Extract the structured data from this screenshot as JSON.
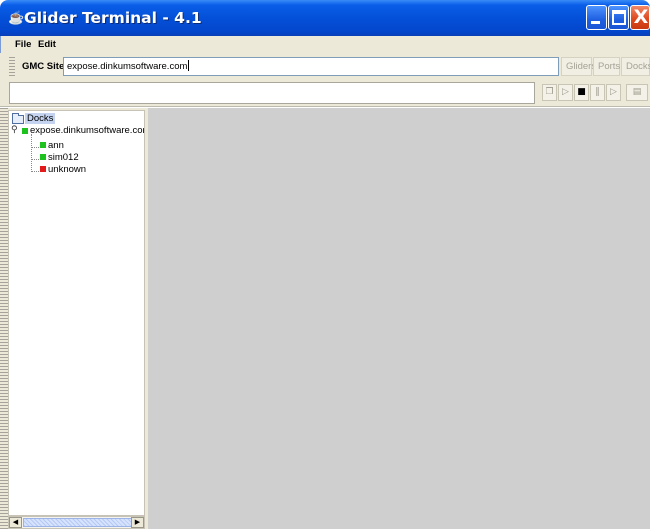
{
  "window": {
    "title": "Glider Terminal - 4.1",
    "buttons": {
      "minimize": "minimize",
      "maximize": "maximize",
      "close": "X"
    }
  },
  "menu": {
    "items": [
      "File",
      "Edit"
    ]
  },
  "site_toolbar": {
    "label": "GMC Site:",
    "site_value": "expose.dinkumsoftware.com",
    "buttons": [
      "Gliders",
      "Ports",
      "Docks"
    ],
    "buttons_enabled": false
  },
  "playback_toolbar": {
    "field_value": "",
    "controls": [
      "open-icon",
      "play-icon",
      "stop-icon",
      "pause-icon",
      "step-icon",
      "terminal-icon"
    ],
    "glyphs": [
      "❐",
      "▷",
      "■",
      "‖",
      "▷",
      "▤"
    ]
  },
  "tree": {
    "root": "Docks",
    "host": "expose.dinkumsoftware.com",
    "gliders": [
      {
        "label": "ann",
        "status_color": "#1ec21e"
      },
      {
        "label": "sim012",
        "status_color": "#1ec21e"
      },
      {
        "label": "unknown",
        "status_color": "#e21a1a"
      }
    ],
    "host_status_color": "#1ec21e"
  },
  "colors": {
    "titlebar": "#0450d8",
    "chrome": "#ece9d8",
    "main_pane": "#cfcfcf",
    "selection": "#c4d4f0"
  }
}
